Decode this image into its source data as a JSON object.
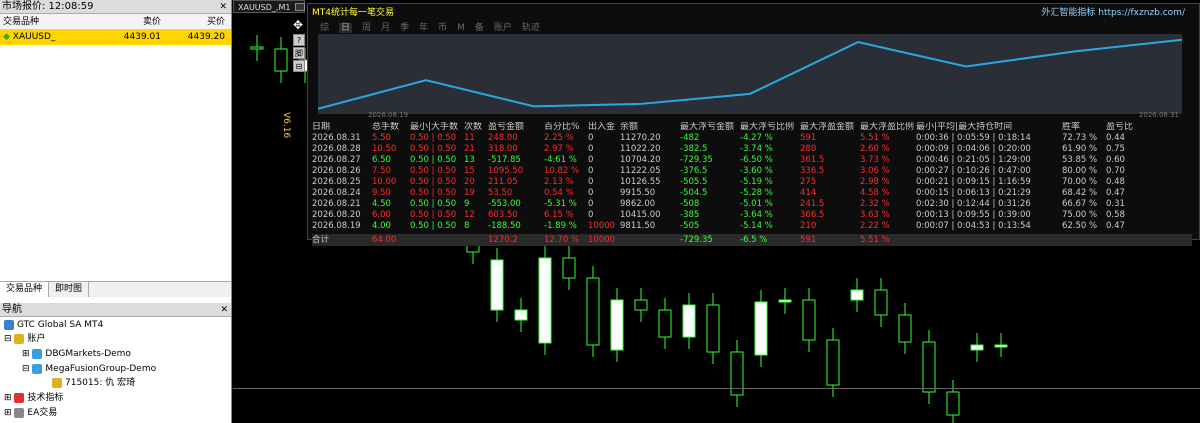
{
  "market": {
    "title": "市场报价: 12:08:59",
    "cols": [
      "交易品种",
      "卖价",
      "买价"
    ],
    "row": {
      "symbol": "XAUUSD_",
      "bid": "4439.01",
      "ask": "4439.20"
    },
    "tabs": [
      "交易品种",
      "即时图"
    ]
  },
  "nav": {
    "title": "导航",
    "items": [
      {
        "label": "GTC Global SA MT4"
      },
      {
        "label": "账户"
      },
      {
        "label": "DBGMarkets-Demo"
      },
      {
        "label": "MegaFusionGroup-Demo"
      },
      {
        "label": "715015: 仇 宏琦"
      },
      {
        "label": "技术指标"
      },
      {
        "label": "EA交易"
      }
    ]
  },
  "chart": {
    "title": "XAUUSD_,M1",
    "version": "V6.16",
    "side_buttons": [
      "?",
      "脚",
      "⊟"
    ],
    "candle_opens": [
      47,
      49,
      71,
      85,
      105,
      100,
      150,
      140,
      180,
      225,
      310,
      320,
      343,
      258,
      278,
      350,
      300,
      310,
      337,
      305,
      352,
      355,
      302,
      300,
      340,
      300,
      290,
      315,
      342,
      392,
      350,
      345
    ],
    "candle_closes": [
      49,
      71,
      60,
      105,
      90,
      150,
      140,
      180,
      225,
      252,
      260,
      310,
      258,
      278,
      345,
      300,
      310,
      337,
      305,
      352,
      395,
      302,
      300,
      340,
      385,
      290,
      315,
      342,
      392,
      415,
      345,
      345
    ]
  },
  "stats": {
    "title": "MT4统计每一笔交易",
    "site": "外汇智能指标 https://fxznzb.com/",
    "tabs": [
      "综",
      "日",
      "周",
      "月",
      "季",
      "年",
      "币",
      "M",
      "备",
      "账户",
      "轨迹"
    ],
    "active_tab": "日",
    "graph_start": "2026.08.19",
    "graph_end": "2026.08.31",
    "equity_curve": [
      9811.5,
      10415.0,
      9862.0,
      9915.5,
      10126.55,
      11222.05,
      10704.2,
      11022.2,
      11270.2
    ],
    "headers": [
      "日期",
      "总手数",
      "最小|大手数",
      "次数",
      "盈亏金额",
      "百分比%",
      "出入金",
      "余额",
      "最大浮亏金额",
      "最大浮亏比例",
      "最大浮盈金额",
      "最大浮盈比例",
      "最小|平均|最大持仓时间",
      "胜率",
      "盈亏比"
    ],
    "rows": [
      {
        "date": "2026.08.31",
        "lots": "5.50",
        "minmax": "0.50 | 0.50",
        "count": "11",
        "pnl": "248.00",
        "pct": "2.25 %",
        "dep": "0",
        "bal": "11270.20",
        "mdd": "-482",
        "mddp": "-4.27 %",
        "mfe": "591",
        "mfep": "5.51 %",
        "hold": "0:00:36 | 0:05:59 | 0:18:14",
        "win": "72.73 %",
        "pf": "0.44",
        "c": "rd"
      },
      {
        "date": "2026.08.28",
        "lots": "10.50",
        "minmax": "0.50 | 0.50",
        "count": "21",
        "pnl": "318.00",
        "pct": "2.97 %",
        "dep": "0",
        "bal": "11022.20",
        "mdd": "-382.5",
        "mddp": "-3.74 %",
        "mfe": "280",
        "mfep": "2.60 %",
        "hold": "0:00:09 | 0:04:06 | 0:20:00",
        "win": "61.90 %",
        "pf": "0.75",
        "c": "rd"
      },
      {
        "date": "2026.08.27",
        "lots": "6.50",
        "minmax": "0.50 | 0.50",
        "count": "13",
        "pnl": "-517.85",
        "pct": "-4.61 %",
        "dep": "0",
        "bal": "10704.20",
        "mdd": "-729.35",
        "mddp": "-6.50 %",
        "mfe": "361.5",
        "mfep": "3.73 %",
        "hold": "0:00:46 | 0:21:05 | 1:29:00",
        "win": "53.85 %",
        "pf": "0.60",
        "c": "gn"
      },
      {
        "date": "2026.08.26",
        "lots": "7.50",
        "minmax": "0.50 | 0.50",
        "count": "15",
        "pnl": "1095.50",
        "pct": "10.82 %",
        "dep": "0",
        "bal": "11222.05",
        "mdd": "-376.5",
        "mddp": "-3.60 %",
        "mfe": "336.5",
        "mfep": "3.06 %",
        "hold": "0:00:27 | 0:10:26 | 0:47:00",
        "win": "80.00 %",
        "pf": "0.70",
        "c": "rd"
      },
      {
        "date": "2026.08.25",
        "lots": "10.00",
        "minmax": "0.50 | 0.50",
        "count": "20",
        "pnl": "211.05",
        "pct": "2.13 %",
        "dep": "0",
        "bal": "10126.55",
        "mdd": "-505.5",
        "mddp": "-5.19 %",
        "mfe": "275",
        "mfep": "2.98 %",
        "hold": "0:00:21 | 0:09:15 | 1:16:59",
        "win": "70.00 %",
        "pf": "0.48",
        "c": "rd"
      },
      {
        "date": "2026.08.24",
        "lots": "9.50",
        "minmax": "0.50 | 0.50",
        "count": "19",
        "pnl": "53.50",
        "pct": "0.54 %",
        "dep": "0",
        "bal": "9915.50",
        "mdd": "-504.5",
        "mddp": "-5.28 %",
        "mfe": "414",
        "mfep": "4.58 %",
        "hold": "0:00:15 | 0:06:13 | 0:21:29",
        "win": "68.42 %",
        "pf": "0.47",
        "c": "rd"
      },
      {
        "date": "2026.08.21",
        "lots": "4.50",
        "minmax": "0.50 | 0.50",
        "count": "9",
        "pnl": "-553.00",
        "pct": "-5.31 %",
        "dep": "0",
        "bal": "9862.00",
        "mdd": "-508",
        "mddp": "-5.01 %",
        "mfe": "241.5",
        "mfep": "2.32 %",
        "hold": "0:02:30 | 0:12:44 | 0:31:26",
        "win": "66.67 %",
        "pf": "0.31",
        "c": "gn"
      },
      {
        "date": "2026.08.20",
        "lots": "6.00",
        "minmax": "0.50 | 0.50",
        "count": "12",
        "pnl": "603.50",
        "pct": "6.15 %",
        "dep": "0",
        "bal": "10415.00",
        "mdd": "-385",
        "mddp": "-3.64 %",
        "mfe": "366.5",
        "mfep": "3.63 %",
        "hold": "0:00:13 | 0:09:55 | 0:39:00",
        "win": "75.00 %",
        "pf": "0.58",
        "c": "rd"
      },
      {
        "date": "2026.08.19",
        "lots": "4.00",
        "minmax": "0.50 | 0.50",
        "count": "8",
        "pnl": "-188.50",
        "pct": "-1.89 %",
        "dep": "10000",
        "bal": "9811.50",
        "mdd": "-505",
        "mddp": "-5.14 %",
        "mfe": "210",
        "mfep": "2.22 %",
        "hold": "0:00:07 | 0:04:53 | 0:13:54",
        "win": "62.50 %",
        "pf": "0.47",
        "c": "gn"
      }
    ],
    "total": {
      "label": "合计",
      "lots": "64.00",
      "pnl": "1270.2",
      "pct": "12.70 %",
      "dep": "10000",
      "mdd": "-729.35",
      "mddp": "-6.5 %",
      "mfe": "591",
      "mfep": "5.51 %"
    }
  }
}
